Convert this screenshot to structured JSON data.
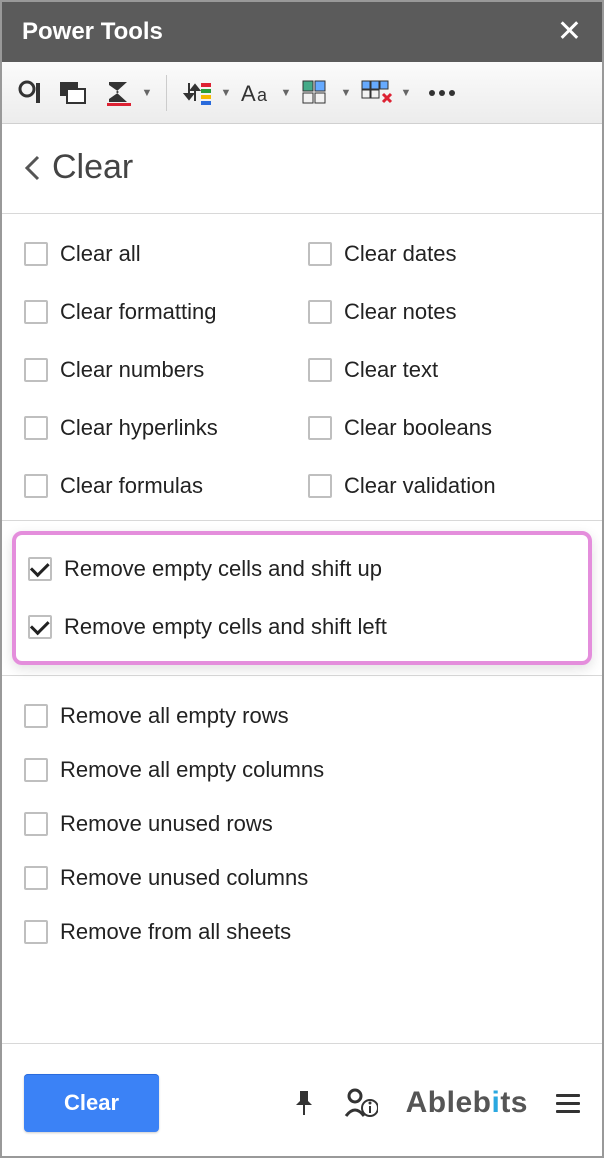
{
  "titlebar": {
    "title": "Power Tools"
  },
  "page": {
    "title": "Clear"
  },
  "clear_grid": {
    "left": [
      {
        "label": "Clear all",
        "checked": false
      },
      {
        "label": "Clear formatting",
        "checked": false
      },
      {
        "label": "Clear numbers",
        "checked": false
      },
      {
        "label": "Clear hyperlinks",
        "checked": false
      },
      {
        "label": "Clear formulas",
        "checked": false
      }
    ],
    "right": [
      {
        "label": "Clear dates",
        "checked": false
      },
      {
        "label": "Clear notes",
        "checked": false
      },
      {
        "label": "Clear text",
        "checked": false
      },
      {
        "label": "Clear booleans",
        "checked": false
      },
      {
        "label": "Clear validation",
        "checked": false
      }
    ]
  },
  "highlighted": [
    {
      "label": "Remove empty cells and shift up",
      "checked": true
    },
    {
      "label": "Remove empty cells and shift left",
      "checked": true
    }
  ],
  "remove_list": [
    {
      "label": "Remove all empty rows",
      "checked": false
    },
    {
      "label": "Remove all empty columns",
      "checked": false
    },
    {
      "label": "Remove unused rows",
      "checked": false
    },
    {
      "label": "Remove unused columns",
      "checked": false
    },
    {
      "label": "Remove from all sheets",
      "checked": false
    }
  ],
  "footer": {
    "button": "Clear",
    "brand": "Ablebits"
  }
}
